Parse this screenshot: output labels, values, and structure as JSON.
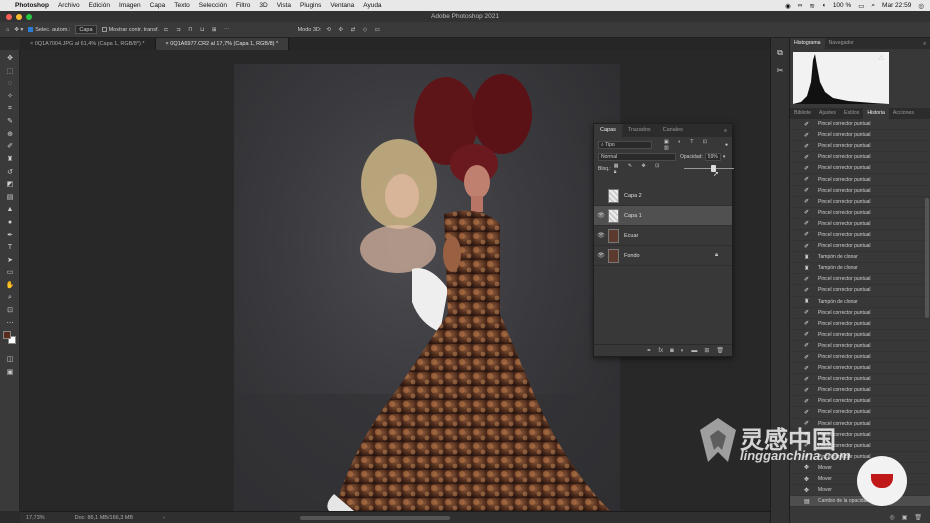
{
  "macbar": {
    "apple": "",
    "app": "Photoshop",
    "menus": [
      "Archivo",
      "Edición",
      "Imagen",
      "Capa",
      "Texto",
      "Selección",
      "Filtro",
      "3D",
      "Vista",
      "Plugins",
      "Ventana",
      "Ayuda"
    ],
    "battery": "100 %",
    "clock": "Mar 22:59"
  },
  "window": {
    "title": "Adobe Photoshop 2021"
  },
  "options": {
    "auto_select_label": "Selec. autom.:",
    "auto_select_value": "Capa",
    "show_transform_label": "Mostrar contr. transf.",
    "mode3d": "Modo 3D:"
  },
  "doctabs": [
    "0Q1A7004.JPG al 61,4% (Capa 1, RGB/8*) *",
    "0Q1A6977.CR2 al 17,7% (Capa 1, RGB/8) *"
  ],
  "status": {
    "zoom": "17,73%",
    "doc": "Doc: 86,1 MB/166,3 MB"
  },
  "layers": {
    "tabs": [
      "Capas",
      "Trazados",
      "Canales"
    ],
    "filter": "Tipo",
    "blend": "Normal",
    "opacity_label": "Opacidad:",
    "opacity_value": "59%",
    "lock_label": "Bloq.:",
    "fill_label": "Relleno:",
    "items": [
      {
        "name": "Capa 2",
        "visible": false,
        "selected": false
      },
      {
        "name": "Capa 1",
        "visible": true,
        "selected": true
      },
      {
        "name": "Ecuar",
        "visible": true,
        "selected": false
      },
      {
        "name": "Fondo",
        "visible": true,
        "selected": false
      }
    ]
  },
  "right": {
    "top_tabs": [
      "Histograma",
      "Navegador"
    ],
    "bottom_tabs": [
      "Bibliote",
      "Ajustes",
      "Estilos",
      "Historia",
      "Acciones"
    ],
    "history": [
      "Pincel corrector puntual",
      "Pincel corrector puntual",
      "Pincel corrector puntual",
      "Pincel corrector puntual",
      "Pincel corrector puntual",
      "Pincel corrector puntual",
      "Pincel corrector puntual",
      "Pincel corrector puntual",
      "Pincel corrector puntual",
      "Pincel corrector puntual",
      "Pincel corrector puntual",
      "Pincel corrector puntual",
      "Tampón de clonar",
      "Tampón de clonar",
      "Pincel corrector puntual",
      "Pincel corrector puntual",
      "Tampón de clonar",
      "Pincel corrector puntual",
      "Pincel corrector puntual",
      "Pincel corrector puntual",
      "Pincel corrector puntual",
      "Pincel corrector puntual",
      "Pincel corrector puntual",
      "Pincel corrector puntual",
      "Pincel corrector puntual",
      "Pincel corrector puntual",
      "Pincel corrector puntual",
      "Pincel corrector puntual",
      "Pincel corrector puntual",
      "Pincel corrector puntual",
      "Pincel corrector puntual",
      "Mover",
      "Mover",
      "Mover",
      "Cambio de la opacidad de capa"
    ]
  },
  "watermark": {
    "brand": "灵感中国",
    "site": "lingganchina.com"
  }
}
